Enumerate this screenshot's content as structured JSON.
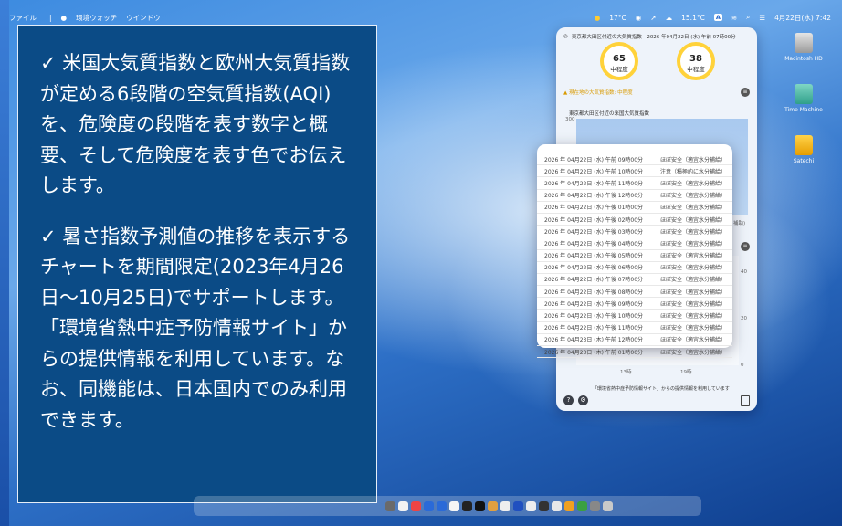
{
  "menubar": {
    "items": [
      "ファイル",
      "環境ウォッチ",
      "ウインドウ"
    ],
    "temp1": "17°C",
    "temp2": "15.1°C",
    "badge": "A",
    "datetime": "4月22日(水) 7:42"
  },
  "promo": {
    "para1": "✓ 米国大気質指数と欧州大気質指数が定める6段階の空気質指数(AQI)を、危険度の段階を表す数字と概要、そして危険度を表す色でお伝えします。",
    "para2": "✓ 暑さ指数予測値の推移を表示するチャートを期間限定(2023年4月26日〜10月25日)でサポートします。「環境省熱中症予防情報サイト」からの提供情報を利用しています。なお、同機能は、日本国内でのみ利用できます。"
  },
  "window": {
    "title": "東京都大田区付近の大気質指数　2026 年04月22日 (水) 午前 07時00分",
    "gauges": [
      {
        "value": "65",
        "level": "中程度"
      },
      {
        "value": "38",
        "level": "中程度"
      }
    ],
    "warning": "現在地の大気質指数: 中程度",
    "chart_title": "東京都大田区付近の米国大気質指数",
    "tick_300": "300",
    "axis_40": "40",
    "axis_20": "20",
    "axis_0": "0",
    "x_13": "13時",
    "x_19": "19時",
    "partial_label": "補助)",
    "footer": "「環境省熱中症予防情報サイト」からの提供情報を利用しています",
    "help": "?",
    "settings": "⚙"
  },
  "popup": {
    "rows": [
      {
        "dt": "2026 年 04月22日 (水) 午前 09時00分",
        "st": "ほぼ安全（適宜水分補給）"
      },
      {
        "dt": "2026 年 04月22日 (水) 午前 10時00分",
        "st": "注意（積極的に水分補給）"
      },
      {
        "dt": "2026 年 04月22日 (水) 午前 11時00分",
        "st": "ほぼ安全（適宜水分補給）"
      },
      {
        "dt": "2026 年 04月22日 (水) 午後 12時00分",
        "st": "ほぼ安全（適宜水分補給）"
      },
      {
        "dt": "2026 年 04月22日 (水) 午後 01時00分",
        "st": "ほぼ安全（適宜水分補給）"
      },
      {
        "dt": "2026 年 04月22日 (水) 午後 02時00分",
        "st": "ほぼ安全（適宜水分補給）"
      },
      {
        "dt": "2026 年 04月22日 (水) 午後 03時00分",
        "st": "ほぼ安全（適宜水分補給）"
      },
      {
        "dt": "2026 年 04月22日 (水) 午後 04時00分",
        "st": "ほぼ安全（適宜水分補給）"
      },
      {
        "dt": "2026 年 04月22日 (水) 午後 05時00分",
        "st": "ほぼ安全（適宜水分補給）"
      },
      {
        "dt": "2026 年 04月22日 (水) 午後 06時00分",
        "st": "ほぼ安全（適宜水分補給）"
      },
      {
        "dt": "2026 年 04月22日 (水) 午後 07時00分",
        "st": "ほぼ安全（適宜水分補給）"
      },
      {
        "dt": "2026 年 04月22日 (水) 午後 08時00分",
        "st": "ほぼ安全（適宜水分補給）"
      },
      {
        "dt": "2026 年 04月22日 (水) 午後 09時00分",
        "st": "ほぼ安全（適宜水分補給）"
      },
      {
        "dt": "2026 年 04月22日 (水) 午後 10時00分",
        "st": "ほぼ安全（適宜水分補給）"
      },
      {
        "dt": "2026 年 04月22日 (水) 午後 11時00分",
        "st": "ほぼ安全（適宜水分補給）"
      },
      {
        "dt": "2026 年 04月23日 (木) 午前 12時00分",
        "st": "ほぼ安全（適宜水分補給）"
      },
      {
        "dt": "2026 年 04月23日 (木) 午前 01時00分",
        "st": "ほぼ安全（適宜水分補給）"
      }
    ]
  },
  "desktop": {
    "icons": [
      "Macintosh HD",
      "Time Machine",
      "Satechi"
    ]
  },
  "colors": {
    "card_bg": "#0b4b86",
    "gauge_ring": "#ffd23a",
    "warning": "#d99a00"
  }
}
